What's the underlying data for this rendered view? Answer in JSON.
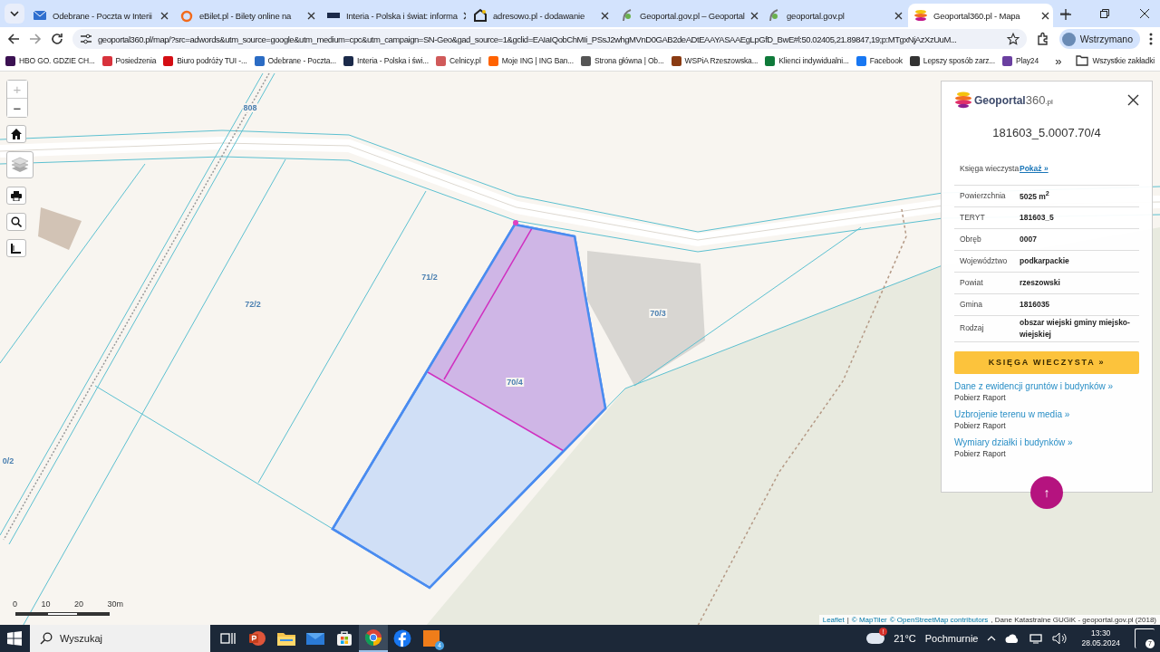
{
  "browser": {
    "tabs": [
      {
        "title": "Odebrane - Poczta w Interii",
        "kind": "mail",
        "selected": false
      },
      {
        "title": "eBilet.pl - Bilety online na",
        "kind": "ebilet",
        "selected": false
      },
      {
        "title": "Interia - Polska i świat: informa",
        "kind": "interia",
        "selected": false
      },
      {
        "title": "adresowo.pl - dodawanie",
        "kind": "house",
        "selected": false
      },
      {
        "title": "Geoportal.gov.pl – Geoportal",
        "kind": "gov",
        "selected": false
      },
      {
        "title": "geoportal.gov.pl",
        "kind": "gov",
        "selected": false
      },
      {
        "title": "Geoportal360.pl - Mapa",
        "kind": "geo360",
        "selected": true
      }
    ],
    "address": "geoportal360.pl/map/?src=adwords&utm_source=google&utm_medium=cpc&utm_campaign=SN-Geo&gad_source=1&gclid=EAIaIQobChMIi_PSsJ2whgMVnD0GAB2deADtEAAYASAAEgLpGfD_BwE#l:50.02405,21.89847,19;p:MTgxNjAzXzUuM...",
    "profile": "Wstrzymano",
    "bookmarks": [
      {
        "title": "HBO GO. GDZIE CH...",
        "color": "#3b1152"
      },
      {
        "title": "Posiedzenia",
        "color": "#d8323c"
      },
      {
        "title": "Biuro podróży TUI -...",
        "color": "#d40e14"
      },
      {
        "title": "Odebrane - Poczta...",
        "color": "#2b6cc4"
      },
      {
        "title": "Interia - Polska i świ...",
        "color": "#1b2a4a"
      },
      {
        "title": "Celnicy.pl",
        "color": "#d05a5a"
      },
      {
        "title": "Moje ING | ING Ban...",
        "color": "#ff6200"
      },
      {
        "title": "Strona główna | Ob...",
        "color": "#555555"
      },
      {
        "title": "WSPiA Rzeszowska...",
        "color": "#8a3b12"
      },
      {
        "title": "Klienci indywidualni...",
        "color": "#0f7a3a"
      },
      {
        "title": "Facebook",
        "color": "#1877f2"
      },
      {
        "title": "Lepszy sposób zarz...",
        "color": "#333333"
      },
      {
        "title": "Play24",
        "color": "#6a3fa0"
      }
    ],
    "more": "»",
    "all_bookmarks": "Wszystkie zakładki"
  },
  "map": {
    "zoom_in": "+",
    "zoom_out": "−",
    "parcel_labels": [
      "808",
      "72/2",
      "71/2",
      "70/3",
      "70/4",
      "0/2"
    ],
    "scale": [
      "0",
      "10",
      "20",
      "30m"
    ],
    "attribution": [
      {
        "text": "Leaflet",
        "kind": "link"
      },
      {
        "text": "|",
        "kind": "text"
      },
      {
        "text": "© MapTiler",
        "kind": "link"
      },
      {
        "text": "© OpenStreetMap contributors",
        "kind": "link"
      },
      {
        "text": ", Dane Katastralne GUGiK - geoportal.gov.pl (2018)",
        "kind": "text"
      }
    ]
  },
  "panel": {
    "logo": "Geoportal",
    "logo_number": "360",
    "logo_suffix": ".pl",
    "parcel_id": "181603_5.0007.70/4",
    "rows": [
      {
        "label": "Księga wieczysta",
        "value": "Pokaż »",
        "kind": "link"
      },
      {
        "label": "Powierzchnia",
        "value": "5025 m$^{2}$",
        "kind": "text"
      },
      {
        "label": "TERYT",
        "value": "181603_5",
        "kind": "text"
      },
      {
        "label": "Obręb",
        "value": "0007",
        "kind": "text"
      },
      {
        "label": "Województwo",
        "value": "podkarpackie",
        "kind": "text"
      },
      {
        "label": "Powiat",
        "value": "rzeszowski",
        "kind": "text"
      },
      {
        "label": "Gmina",
        "value": "1816035",
        "kind": "text"
      },
      {
        "label": "Rodzaj",
        "value": "obszar wiejski gminy miejsko-wiejskiej",
        "kind": "text"
      }
    ],
    "button": "KSIĘGA WIECZYSTA »",
    "reports": [
      {
        "link": "Dane z ewidencji gruntów i budynków »",
        "action": "Pobierz Raport"
      },
      {
        "link": "Uzbrojenie terenu w media »",
        "action": "Pobierz Raport"
      },
      {
        "link": "Wymiary działki i budynków »",
        "action": "Pobierz Raport"
      }
    ],
    "scroll_top": "↑"
  },
  "taskbar": {
    "search_placeholder": "Wyszukaj",
    "apps": [
      {
        "kind": "taskview",
        "selected": false
      },
      {
        "kind": "powerpoint",
        "selected": false
      },
      {
        "kind": "folder",
        "selected": false
      },
      {
        "kind": "mail",
        "selected": false
      },
      {
        "kind": "store",
        "selected": false
      },
      {
        "kind": "chrome",
        "selected": true
      },
      {
        "kind": "facebook",
        "selected": false
      },
      {
        "kind": "photos",
        "selected": false
      }
    ],
    "app_badge": "4",
    "temperature": "21°C",
    "weather": "Pochmurnie",
    "weather_alert": "!",
    "time": "13:30",
    "date": "28.05.2024",
    "notifications": "7"
  }
}
